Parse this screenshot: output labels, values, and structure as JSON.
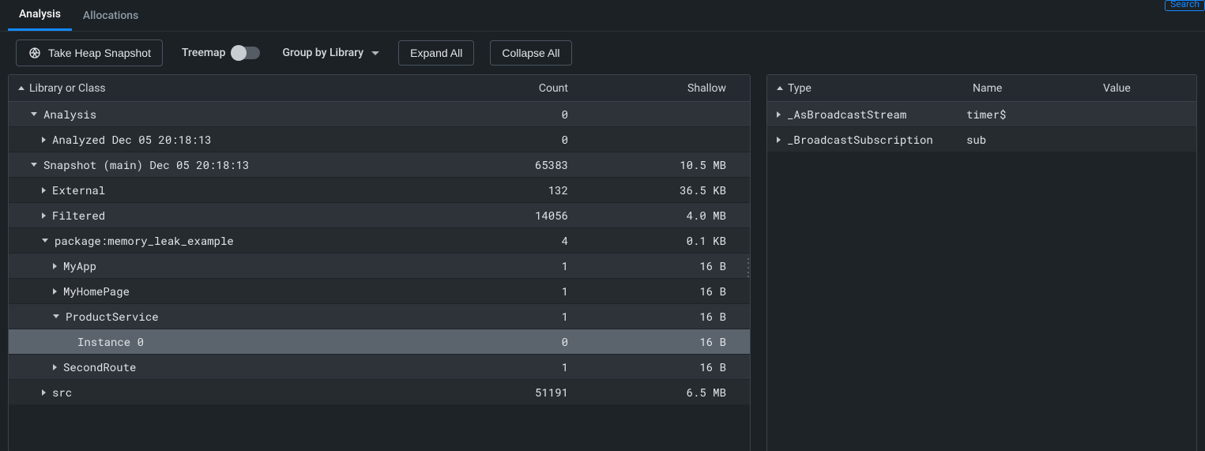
{
  "search_label": "Search",
  "tabs": {
    "analysis": "Analysis",
    "allocations": "Allocations"
  },
  "toolbar": {
    "snapshot": "Take Heap Snapshot",
    "treemap": "Treemap",
    "group_by": "Group by Library",
    "expand_all": "Expand All",
    "collapse_all": "Collapse All"
  },
  "left": {
    "headers": {
      "lib": "Library or Class",
      "count": "Count",
      "shallow": "Shallow"
    },
    "rows": [
      {
        "indent": 1,
        "caret": "down",
        "label": "Analysis",
        "count": "0",
        "shallow": "",
        "alt": true
      },
      {
        "indent": 2,
        "caret": "right",
        "label": "Analyzed Dec 05 20:18:13",
        "count": "0",
        "shallow": "",
        "alt": false
      },
      {
        "indent": 1,
        "caret": "down",
        "label": "Snapshot (main) Dec 05 20:18:13",
        "count": "65383",
        "shallow": "10.5 MB",
        "alt": true
      },
      {
        "indent": 2,
        "caret": "right",
        "label": "External",
        "count": "132",
        "shallow": "36.5 KB",
        "alt": false
      },
      {
        "indent": 2,
        "caret": "right",
        "label": "Filtered",
        "count": "14056",
        "shallow": "4.0 MB",
        "alt": true
      },
      {
        "indent": 2,
        "caret": "down",
        "label": "package:memory_leak_example",
        "count": "4",
        "shallow": "0.1 KB",
        "alt": false
      },
      {
        "indent": 3,
        "caret": "right",
        "label": "MyApp",
        "count": "1",
        "shallow": "16 B",
        "alt": true
      },
      {
        "indent": 3,
        "caret": "right",
        "label": "MyHomePage",
        "count": "1",
        "shallow": "16 B",
        "alt": false
      },
      {
        "indent": 3,
        "caret": "down",
        "label": "ProductService",
        "count": "1",
        "shallow": "16 B",
        "alt": true
      },
      {
        "indent": 4,
        "caret": "none",
        "label": "Instance 0",
        "count": "0",
        "shallow": "16 B",
        "selected": true
      },
      {
        "indent": 3,
        "caret": "right",
        "label": "SecondRoute",
        "count": "1",
        "shallow": "16 B",
        "alt": true
      },
      {
        "indent": 2,
        "caret": "right",
        "label": "src",
        "count": "51191",
        "shallow": "6.5 MB",
        "alt": false
      }
    ]
  },
  "right": {
    "headers": {
      "type": "Type",
      "name": "Name",
      "value": "Value"
    },
    "rows": [
      {
        "caret": "right",
        "type": "_AsBroadcastStream",
        "name": "timer$",
        "value": "",
        "alt": true
      },
      {
        "caret": "right",
        "type": "_BroadcastSubscription",
        "name": "sub",
        "value": "",
        "alt": false
      }
    ]
  }
}
